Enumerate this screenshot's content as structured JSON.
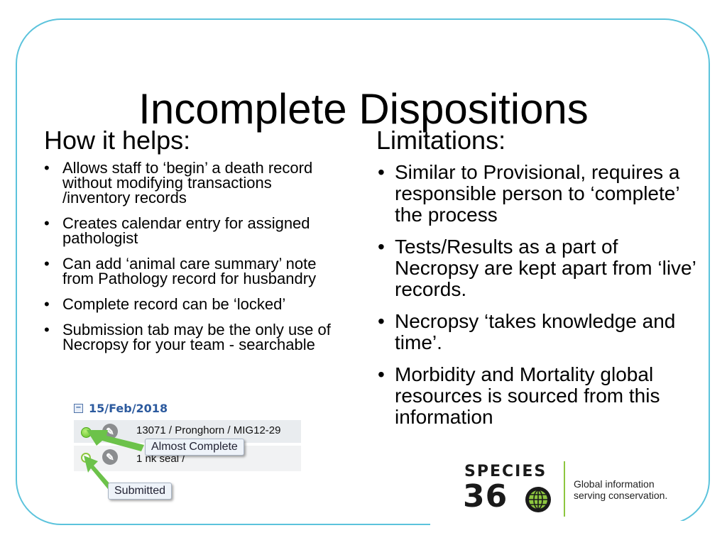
{
  "slide": {
    "title": "Incomplete Dispositions",
    "left": {
      "heading": "How it helps:",
      "bullets": [
        "Allows staff to ‘begin’ a death record without modifying transactions /inventory records",
        "Creates calendar entry for assigned pathologist",
        "Can add ‘animal care summary’ note from Pathology record for husbandry",
        "Complete record can be ‘locked’",
        "Submission tab may be the only use of Necropsy for your team - searchable"
      ]
    },
    "right": {
      "heading": "Limitations:",
      "bullets": [
        "Similar to Provisional, requires a responsible person to ‘complete’ the process",
        "Tests/Results as a part of Necropsy are kept apart from ‘live’ records.",
        "Necropsy ‘takes knowledge and time’.",
        "Morbidity and Mortality global resources is sourced from this information"
      ]
    }
  },
  "screenshot": {
    "date": "15/Feb/2018",
    "collapse_symbol": "−",
    "rows": [
      {
        "text": "13071 / Pronghorn / MIG12-29",
        "status_icon": "filled-green-dot-icon"
      },
      {
        "text": "1              nk seal /",
        "status_icon": "empty-green-circle-icon"
      }
    ],
    "edit_icon_glyph": "✎",
    "callouts": [
      "Almost Complete",
      "Submitted"
    ],
    "accent_color": "#5fbf26"
  },
  "logo": {
    "line1": "SPECIES",
    "line2": "36",
    "tagline_line1": "Global information",
    "tagline_line2": "serving conservation."
  },
  "colors": {
    "frame": "#5bc3dc",
    "date_blue": "#2c5a9e",
    "logo_green": "#8dc63f"
  }
}
